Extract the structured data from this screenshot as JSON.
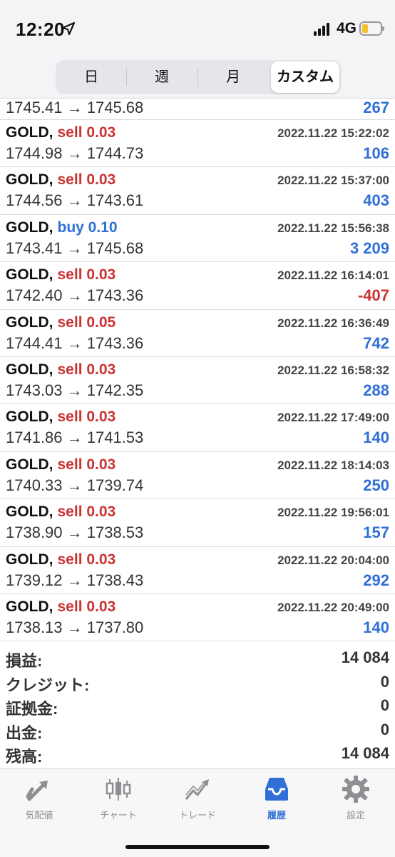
{
  "status_bar": {
    "time": "12:20",
    "network": "4G"
  },
  "period_tabs": [
    {
      "label": "日",
      "active": false
    },
    {
      "label": "週",
      "active": false
    },
    {
      "label": "月",
      "active": false
    },
    {
      "label": "カスタム",
      "active": true
    }
  ],
  "partial_row": {
    "prices": "1745.41 → 1745.68",
    "profit": "267"
  },
  "trades": [
    {
      "symbol": "GOLD,",
      "side": "sell 0.03",
      "type": "sell",
      "datetime": "2022.11.22 15:22:02",
      "prices": "1744.98 → 1744.73",
      "profit": "106"
    },
    {
      "symbol": "GOLD,",
      "side": "sell 0.03",
      "type": "sell",
      "datetime": "2022.11.22 15:37:00",
      "prices": "1744.56 → 1743.61",
      "profit": "403"
    },
    {
      "symbol": "GOLD,",
      "side": "buy 0.10",
      "type": "buy",
      "datetime": "2022.11.22 15:56:38",
      "prices": "1743.41 → 1745.68",
      "profit": "3 209"
    },
    {
      "symbol": "GOLD,",
      "side": "sell 0.03",
      "type": "sell",
      "datetime": "2022.11.22 16:14:01",
      "prices": "1742.40 → 1743.36",
      "profit": "-407"
    },
    {
      "symbol": "GOLD,",
      "side": "sell 0.05",
      "type": "sell",
      "datetime": "2022.11.22 16:36:49",
      "prices": "1744.41 → 1743.36",
      "profit": "742"
    },
    {
      "symbol": "GOLD,",
      "side": "sell 0.03",
      "type": "sell",
      "datetime": "2022.11.22 16:58:32",
      "prices": "1743.03 → 1742.35",
      "profit": "288"
    },
    {
      "symbol": "GOLD,",
      "side": "sell 0.03",
      "type": "sell",
      "datetime": "2022.11.22 17:49:00",
      "prices": "1741.86 → 1741.53",
      "profit": "140"
    },
    {
      "symbol": "GOLD,",
      "side": "sell 0.03",
      "type": "sell",
      "datetime": "2022.11.22 18:14:03",
      "prices": "1740.33 → 1739.74",
      "profit": "250"
    },
    {
      "symbol": "GOLD,",
      "side": "sell 0.03",
      "type": "sell",
      "datetime": "2022.11.22 19:56:01",
      "prices": "1738.90 → 1738.53",
      "profit": "157"
    },
    {
      "symbol": "GOLD,",
      "side": "sell 0.03",
      "type": "sell",
      "datetime": "2022.11.22 20:04:00",
      "prices": "1739.12 → 1738.43",
      "profit": "292"
    },
    {
      "symbol": "GOLD,",
      "side": "sell 0.03",
      "type": "sell",
      "datetime": "2022.11.22 20:49:00",
      "prices": "1738.13 → 1737.80",
      "profit": "140"
    }
  ],
  "summary": [
    {
      "label": "損益:",
      "value": "14 084"
    },
    {
      "label": "クレジット:",
      "value": "0"
    },
    {
      "label": "証拠金:",
      "value": "0"
    },
    {
      "label": "出金:",
      "value": "0"
    },
    {
      "label": "残高:",
      "value": "14 084"
    }
  ],
  "tabbar": [
    {
      "label": "気配値",
      "icon": "quotes-icon",
      "active": false
    },
    {
      "label": "チャート",
      "icon": "chart-icon",
      "active": false
    },
    {
      "label": "トレード",
      "icon": "trade-icon",
      "active": false
    },
    {
      "label": "履歴",
      "icon": "history-icon",
      "active": true
    },
    {
      "label": "設定",
      "icon": "settings-icon",
      "active": false
    }
  ],
  "colors": {
    "sell": "#cc3333",
    "buy": "#2f6fd6",
    "positive": "#2f6fd6",
    "negative": "#cc3333",
    "active_tab": "#2f6fd6",
    "inactive_tab": "#8e8e93"
  }
}
